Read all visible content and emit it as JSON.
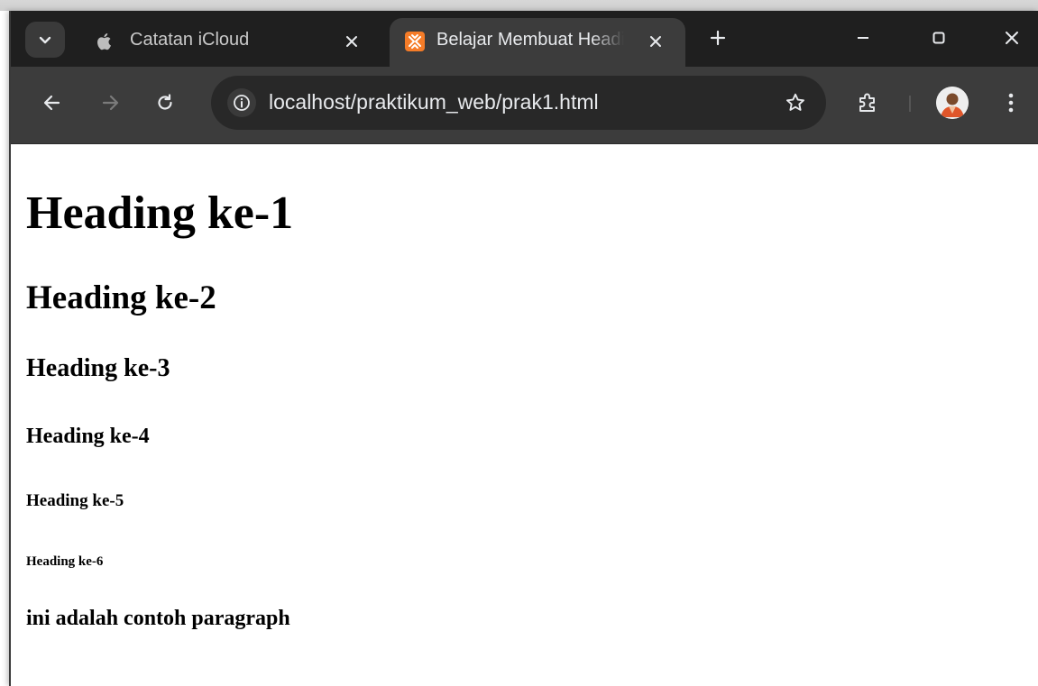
{
  "browser": {
    "tabs": [
      {
        "title": "Catatan iCloud",
        "favicon": "apple-icon",
        "active": false
      },
      {
        "title": "Belajar Membuat Heading",
        "favicon": "xampp-icon",
        "active": true
      }
    ],
    "address_bar": {
      "url": "localhost/praktikum_web/prak1.html"
    },
    "colors": {
      "tabbar": "#1f1f1f",
      "toolbar": "#3c3c3c",
      "omnibox": "#282828",
      "xampp_orange": "#f57c28"
    }
  },
  "page": {
    "headings": {
      "h1": "Heading ke-1",
      "h2": "Heading ke-2",
      "h3": "Heading ke-3",
      "h4": "Heading ke-4",
      "h5": "Heading ke-5",
      "h6": "Heading ke-6"
    },
    "paragraph": "ini adalah contoh paragraph"
  }
}
